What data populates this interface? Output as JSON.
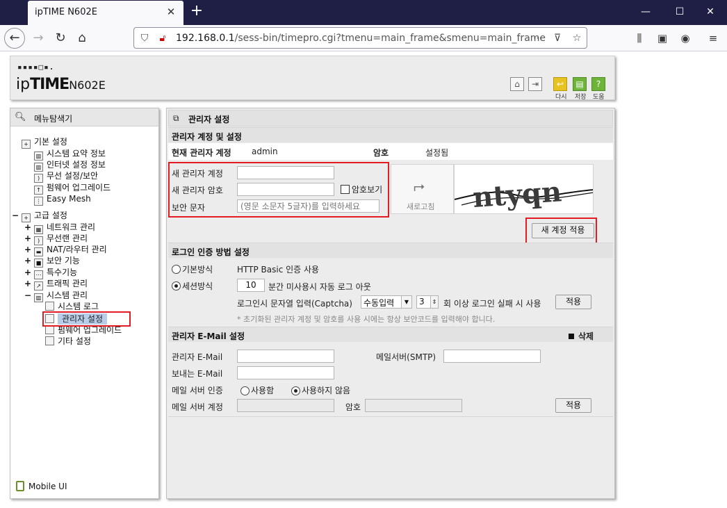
{
  "browser": {
    "tab_title": "ipTIME N602E",
    "url_host": "192.168.0.1",
    "url_path": "/sess-bin/timepro.cgi?tmenu=main_frame&smenu=main_frame"
  },
  "header": {
    "logo_dots": "▪▪▪▪□▪.",
    "logo_ip": "ip",
    "logo_time": "TIME",
    "logo_model": "N602E",
    "btn_back_label": "다시",
    "btn_save_label": "저장",
    "btn_help_label": "도움"
  },
  "sidebar": {
    "title": "메뉴탐색기",
    "basic": {
      "label": "기본 설정",
      "items": [
        "시스템 요약 정보",
        "인터넷 설정 정보",
        "무선 설정/보안",
        "펌웨어 업그레이드",
        "Easy Mesh"
      ]
    },
    "advanced": {
      "label": "고급 설정",
      "items": [
        "네트워크 관리",
        "무선랜 관리",
        "NAT/라우터 관리",
        "보안 기능",
        "특수기능",
        "트래픽 관리",
        "시스템 관리"
      ],
      "system_items": [
        "시스템 로그",
        "관리자 설정",
        "펌웨어 업그레이드",
        "기타 설정"
      ]
    },
    "mobile_ui": "Mobile UI"
  },
  "main": {
    "title": "관리자 설정",
    "account_section": {
      "title": "관리자 계정 및 설정",
      "current_label": "현재 관리자 계정",
      "current_value": "admin",
      "password_label": "암호",
      "password_status": "설정됨",
      "new_account_label": "새 관리자 계정",
      "new_password_label": "새 관리자 암호",
      "show_password_label": "암호보기",
      "security_text_label": "보안 문자",
      "security_text_placeholder": "(영문 소문자 5글자)를 입력하세요",
      "refresh_label": "새로고침",
      "captcha_text": "ntyqn",
      "apply_new_account": "새 계정 적용"
    },
    "login_section": {
      "title": "로그인 인증 방법 설정",
      "basic_mode_label": "기본방식",
      "basic_mode_desc": "HTTP Basic 인증 사용",
      "session_mode_label": "세션방식",
      "session_minutes": "10",
      "session_desc": "분간 미사용시 자동 로그 아웃",
      "captcha_label": "로그인시 문자열 입력(Captcha)",
      "captcha_mode": "수동입력",
      "fail_count": "3",
      "fail_desc": "회 이상 로그인 실패 시 사용",
      "apply": "적용",
      "note": "* 초기화된 관리자 계정 및 암호를 사용 시에는 항상 보안코드를 입력해야 합니다."
    },
    "email_section": {
      "title": "관리자 E-Mail 설정",
      "delete_label": "삭제",
      "admin_email_label": "관리자 E-Mail",
      "smtp_label": "메일서버(SMTP)",
      "sender_email_label": "보내는 E-Mail",
      "auth_label": "메일 서버 인증",
      "auth_use": "사용함",
      "auth_not_use": "사용하지 않음",
      "account_label": "메일 서버 계정",
      "password_label": "암호",
      "apply": "적용"
    }
  }
}
